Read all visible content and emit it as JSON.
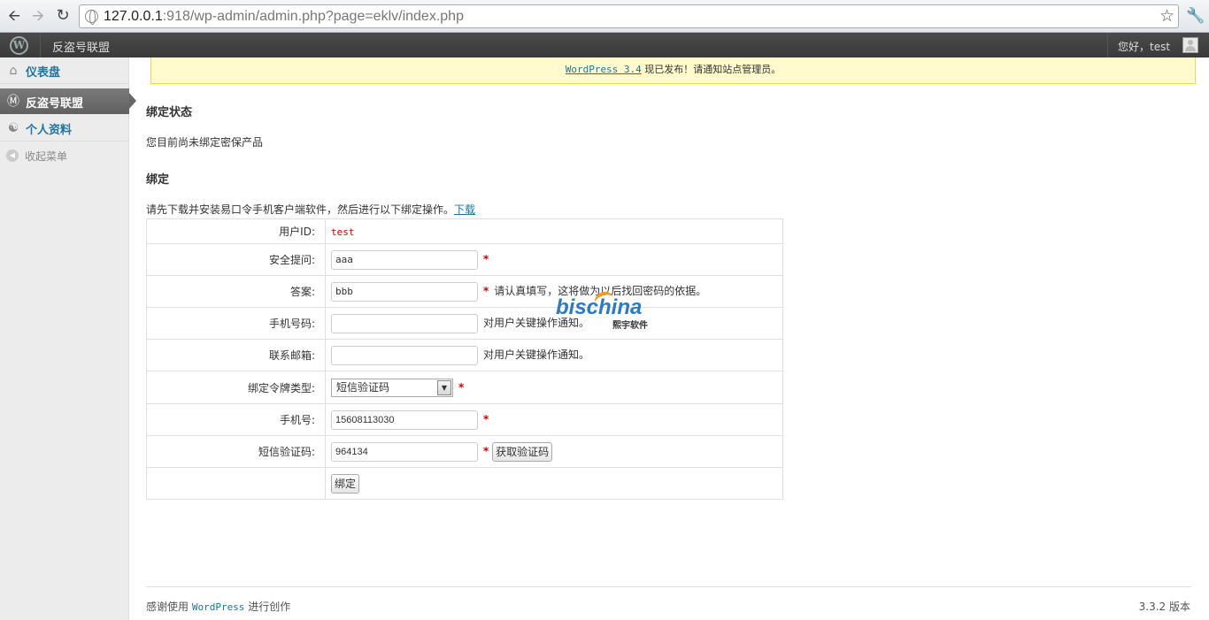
{
  "browser": {
    "url_host": "127.0.0.1",
    "url_rest": ":918/wp-admin/admin.php?page=eklv/index.php"
  },
  "adminbar": {
    "site_name": "反盗号联盟",
    "howdy": "您好，test"
  },
  "sidebar": {
    "items": [
      {
        "label": "仪表盘",
        "icon": "home-icon"
      },
      {
        "label": "反盗号联盟",
        "icon": "wordpress-icon"
      },
      {
        "label": "个人资料",
        "icon": "users-icon"
      },
      {
        "label": "收起菜单",
        "icon": "collapse-arrow-icon"
      }
    ]
  },
  "notice": {
    "link_text": "WordPress 3.4",
    "text": " 现已发布！请通知站点管理员。"
  },
  "main": {
    "status_heading": "绑定状态",
    "status_text": "您目前尚未绑定密保产品",
    "bind_heading": "绑定",
    "intro_text": "请先下载并安装易口令手机客户端软件，然后进行以下绑定操作。",
    "download_link": "下载"
  },
  "form": {
    "user_id_label": "用户ID:",
    "user_id_value": "test",
    "question_label": "安全提问:",
    "question_value": "aaa",
    "answer_label": "答案:",
    "answer_value": "bbb",
    "answer_hint": "请认真填写，这将做为以后找回密码的依据。",
    "phone_label": "手机号码:",
    "phone_hint": "对用户关键操作通知。",
    "email_label": "联系邮箱:",
    "email_hint": "对用户关键操作通知。",
    "token_type_label": "绑定令牌类型:",
    "token_type_value": "短信验证码",
    "mobile_label": "手机号:",
    "mobile_value": "15608113030",
    "sms_code_label": "短信验证码:",
    "sms_code_value": "964134",
    "get_code_button": "获取验证码",
    "bind_button": "绑定",
    "required_mark": "*"
  },
  "watermark": {
    "brand": "bischina",
    "sub": "熙宇软件"
  },
  "footer": {
    "thanks_prefix": "感谢使用 ",
    "thanks_link": "WordPress",
    "thanks_suffix": " 进行创作",
    "version": "3.3.2 版本"
  },
  "colors": {
    "link": "#21759b",
    "required": "#cc0000",
    "notice_bg": "#fffbcc",
    "adminbar_bg": "#464646"
  }
}
